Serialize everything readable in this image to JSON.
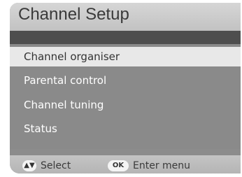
{
  "header": {
    "title": "Channel Setup"
  },
  "menu": {
    "items": [
      {
        "label": "Channel organiser",
        "selected": true
      },
      {
        "label": "Parental control",
        "selected": false
      },
      {
        "label": "Channel tuning",
        "selected": false
      },
      {
        "label": "Status",
        "selected": false
      }
    ]
  },
  "footer": {
    "select_icon": "up-down-arrows-icon",
    "select_label": "Select",
    "ok_button": "OK",
    "ok_label": "Enter menu"
  }
}
